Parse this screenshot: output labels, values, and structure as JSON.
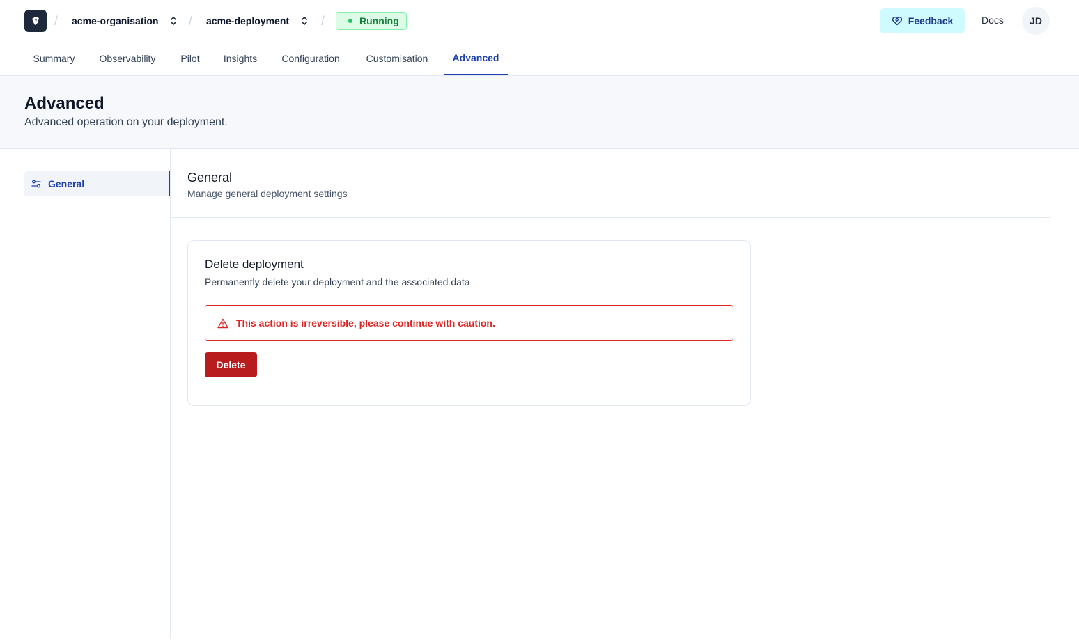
{
  "header": {
    "breadcrumb_separator": "/",
    "organisation": "acme-organisation",
    "deployment": "acme-deployment",
    "status": "Running",
    "feedback_label": "Feedback",
    "docs_label": "Docs",
    "avatar_initials": "JD"
  },
  "tabs": [
    {
      "label": "Summary"
    },
    {
      "label": "Observability"
    },
    {
      "label": "Pilot"
    },
    {
      "label": "Insights"
    },
    {
      "label": "Configuration"
    },
    {
      "label": "Customisation"
    },
    {
      "label": "Advanced",
      "active": true
    }
  ],
  "page": {
    "title": "Advanced",
    "subtitle": "Advanced operation on your deployment."
  },
  "sidenav": {
    "items": [
      {
        "label": "General",
        "icon": "settings-sliders-icon",
        "active": true
      }
    ]
  },
  "section": {
    "title": "General",
    "subtitle": "Manage general deployment settings"
  },
  "delete_card": {
    "title": "Delete deployment",
    "description": "Permanently delete your deployment and the associated data",
    "warning": "This action is irreversible, please continue with caution.",
    "button_label": "Delete"
  },
  "colors": {
    "accent": "#1e40af",
    "status_bg": "#dcfce7",
    "status_text": "#15803d",
    "danger": "#dc2626",
    "danger_button": "#b91c1c",
    "feedback_bg": "#cffafe"
  }
}
